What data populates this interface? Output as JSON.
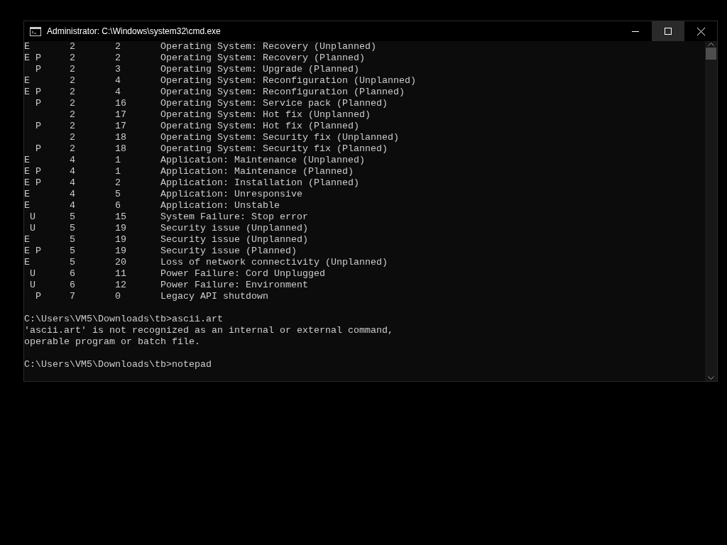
{
  "window": {
    "title": "Administrator: C:\\Windows\\system32\\cmd.exe",
    "controls": [
      {
        "kind": "minimize",
        "hovered": false
      },
      {
        "kind": "maximize",
        "hovered": true
      },
      {
        "kind": "close",
        "hovered": false
      }
    ]
  },
  "console": {
    "blocks": [
      {
        "lines": [
          "E       2       2       Operating System: Recovery (Unplanned)",
          "E P     2       2       Operating System: Recovery (Planned)",
          "  P     2       3       Operating System: Upgrade (Planned)",
          "E       2       4       Operating System: Reconfiguration (Unplanned)",
          "E P     2       4       Operating System: Reconfiguration (Planned)",
          "  P     2       16      Operating System: Service pack (Planned)",
          "        2       17      Operating System: Hot fix (Unplanned)",
          "  P     2       17      Operating System: Hot fix (Planned)",
          "        2       18      Operating System: Security fix (Unplanned)",
          "  P     2       18      Operating System: Security fix (Planned)",
          "E       4       1       Application: Maintenance (Unplanned)",
          "E P     4       1       Application: Maintenance (Planned)",
          "E P     4       2       Application: Installation (Planned)",
          "E       4       5       Application: Unresponsive",
          "E       4       6       Application: Unstable",
          " U      5       15      System Failure: Stop error",
          " U      5       19      Security issue (Unplanned)",
          "E       5       19      Security issue (Unplanned)",
          "E P     5       19      Security issue (Planned)",
          "E       5       20      Loss of network connectivity (Unplanned)",
          " U      6       11      Power Failure: Cord Unplugged",
          " U      6       12      Power Failure: Environment",
          "  P     7       0       Legacy API shutdown"
        ]
      },
      {
        "lines": [
          "C:\\Users\\VM5\\Downloads\\tb>ascii.art",
          "'ascii.art' is not recognized as an internal or external command,",
          "operable program or batch file."
        ]
      },
      {
        "lines": [
          "C:\\Users\\VM5\\Downloads\\tb>notepad"
        ]
      }
    ]
  }
}
